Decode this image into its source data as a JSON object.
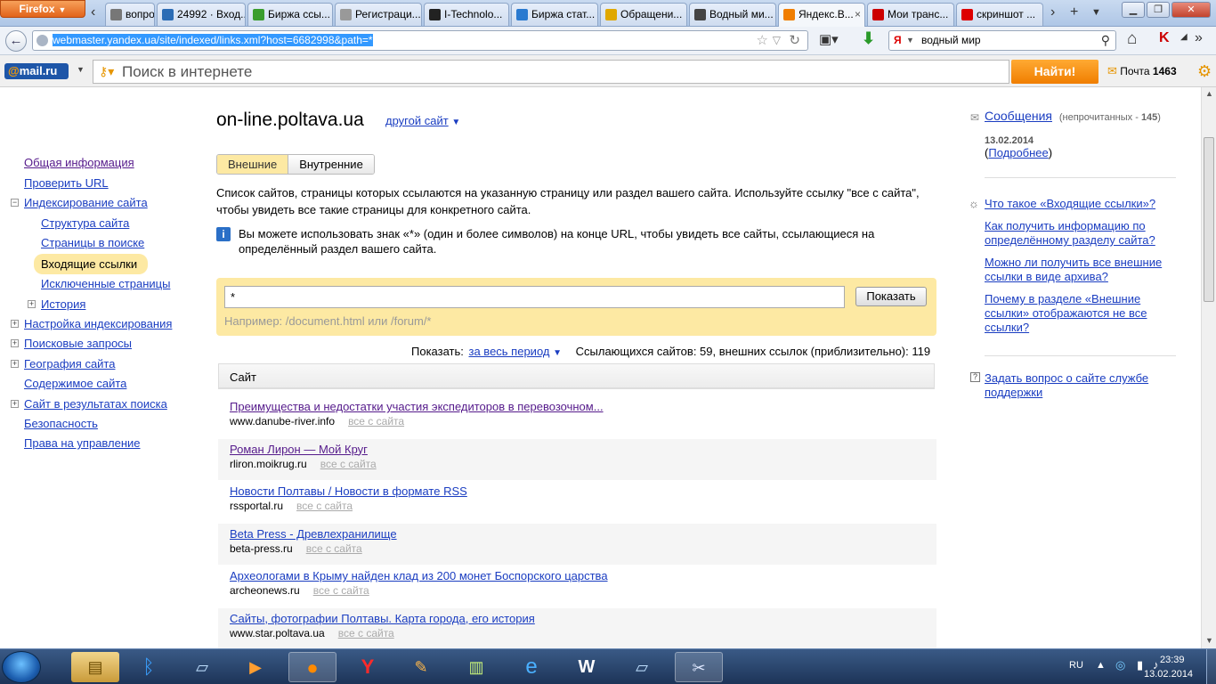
{
  "browser": {
    "app_button": "Firefox",
    "tabs": [
      {
        "label": "вопрос...",
        "color": "#777"
      },
      {
        "label": "24992 · Вход...",
        "color": "#2b6cb5"
      },
      {
        "label": "Биржа ссы...",
        "color": "#3a9d2d"
      },
      {
        "label": "Регистраци...",
        "color": "#999"
      },
      {
        "label": "I-Technolo...",
        "color": "#222"
      },
      {
        "label": "Биржа стат...",
        "color": "#2a7ad0"
      },
      {
        "label": "Обращени...",
        "color": "#e0a800"
      },
      {
        "label": "Водный ми...",
        "color": "#444"
      },
      {
        "label": "Яндекс.В...",
        "color": "#f07e00"
      },
      {
        "label": "Мои транс...",
        "color": "#c00"
      },
      {
        "label": "скриншот ...",
        "color": "#d00"
      }
    ],
    "url": "webmaster.yandex.ua/site/indexed/links.xml?host=6682998&path=*",
    "search_value": "водный мир"
  },
  "mailbar": {
    "logo": "@mail.ru",
    "logo_prefix": "@",
    "logo_rest": "mail.ru",
    "search_placeholder": "Поиск в интернете",
    "find_button": "Найти!",
    "mail_label": "Почта",
    "mail_count": "1463"
  },
  "page": {
    "site_title": "on-line.poltava.ua",
    "other_site": "другой сайт",
    "tabs": {
      "external": "Внешние",
      "internal": "Внутренние"
    },
    "description": "Список сайтов, страницы которых ссылаются на указанную страницу или раздел вашего сайта. Используйте ссылку \"все с сайта\", чтобы увидеть все такие страницы для конкретного сайта.",
    "info": "Вы можете использовать знак «*» (один и более символов) на конце URL, чтобы увидеть все сайты, ссылающиеся на определённый раздел вашего сайта.",
    "filter_value": "*",
    "show_button": "Показать",
    "example": "Например: /document.html или /forum/*",
    "show_label": "Показать:",
    "period": "за весь период",
    "stats": "Ссылающихся сайтов: 59, внешних ссылок (приблизительно): 119",
    "table_header": "Сайт",
    "all_from_site": "все с сайта",
    "rows": [
      {
        "title": "Преимущества и недостатки участия экспедиторов в перевозочном...",
        "domain": "www.danube-river.info",
        "visited": true
      },
      {
        "title": "Роман Лирон — Мой Круг",
        "domain": "rliron.moikrug.ru",
        "visited": true
      },
      {
        "title": "Новости Полтавы / Новости в формате RSS",
        "domain": "rssportal.ru",
        "visited": false
      },
      {
        "title": "Beta Press - Древлехранилище",
        "domain": "beta-press.ru",
        "visited": false
      },
      {
        "title": "Археологами в Крыму найден клад из 200 монет Боспорского царства",
        "domain": "archeonews.ru",
        "visited": false
      },
      {
        "title": "Сайты, фотографии Полтавы. Карта города, его история",
        "domain": "www.star.poltava.ua",
        "visited": false
      }
    ]
  },
  "leftnav": {
    "items": [
      "Общая информация",
      "Проверить URL",
      "Индексирование сайта",
      "Структура сайта",
      "Страницы в поиске",
      "Входящие ссылки",
      "Исключенные страницы",
      "История",
      "Настройка индексирования",
      "Поисковые запросы",
      "География сайта",
      "Содержимое сайта",
      "Сайт в результатах поиска",
      "Безопасность",
      "Права на управление"
    ]
  },
  "rightcol": {
    "messages": "Сообщения",
    "unread": "(непрочитанных -",
    "unread_count": "145",
    "unread_close": ")",
    "date": "13.02.2014",
    "details": "Подробнее",
    "help_links": [
      "Что такое «Входящие ссылки»?",
      "Как получить информацию по определённому разделу сайта?",
      "Можно ли получить все внешние ссылки в виде архива?",
      "Почему в разделе «Внешние ссылки» отображаются не все ссылки?"
    ],
    "ask": "Задать вопрос о сайте службе поддержки"
  },
  "taskbar": {
    "lang": "RU",
    "time": "23:39",
    "date": "13.02.2014"
  }
}
